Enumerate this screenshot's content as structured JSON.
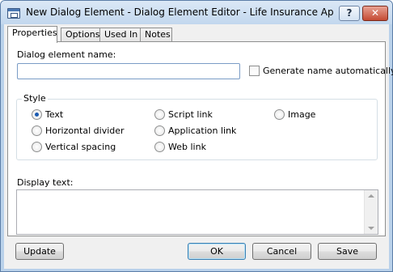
{
  "window": {
    "title": "New Dialog Element - Dialog Element Editor - Life Insurance Applicati...",
    "help_label": "?",
    "close_label": "✕"
  },
  "tabs": [
    {
      "label": "Properties",
      "active": true
    },
    {
      "label": "Options",
      "active": false
    },
    {
      "label": "Used In",
      "active": false
    },
    {
      "label": "Notes",
      "active": false
    }
  ],
  "form": {
    "name_label": "Dialog element name:",
    "name_value": "",
    "auto_name_label": "Generate name automatically",
    "auto_name_checked": false,
    "style_label": "Style",
    "style_options": [
      {
        "label": "Text",
        "checked": true
      },
      {
        "label": "Horizontal divider",
        "checked": false
      },
      {
        "label": "Vertical spacing",
        "checked": false
      },
      {
        "label": "Script link",
        "checked": false
      },
      {
        "label": "Application link",
        "checked": false
      },
      {
        "label": "Web link",
        "checked": false
      },
      {
        "label": "Image",
        "checked": false
      }
    ],
    "display_text_label": "Display text:",
    "display_text_value": ""
  },
  "buttons": {
    "update": "Update",
    "ok": "OK",
    "cancel": "Cancel",
    "save": "Save"
  },
  "colors": {
    "title_bar": "#c2d7ee",
    "default_button_border": "#3c7fb1",
    "radio_dot": "#1a5ab1"
  }
}
